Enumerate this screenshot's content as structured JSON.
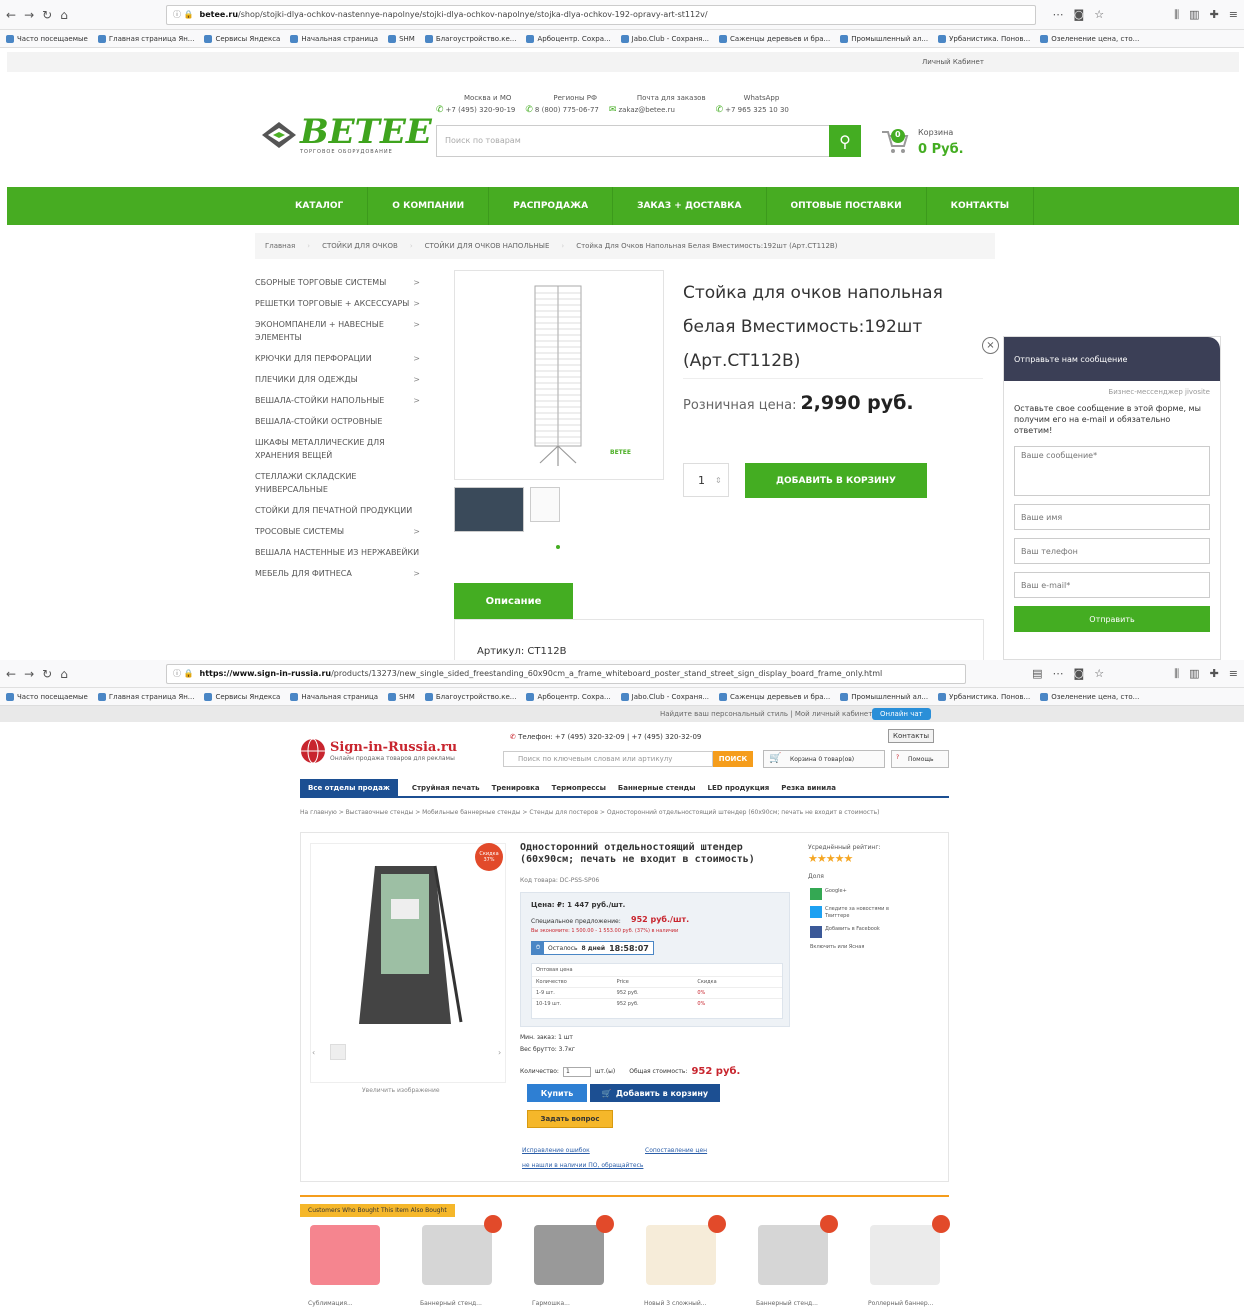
{
  "top": {
    "browser": {
      "url_prefix": "betee.ru",
      "url_rest": "/shop/stojki-dlya-ochkov-nastennye-napolnye/stojki-dlya-ochkov-napolnye/stojka-dlya-ochkov-192-opravy-art-st112v/",
      "bookmarks": [
        "Часто посещаемые",
        "Главная страница Ян...",
        "Сервисы Яндекса",
        "Начальная страница",
        "SHM",
        "Благоустройство.ке...",
        "Арбоцентр. Сохра...",
        "Jabo.Club - Сохраня...",
        "Саженцы деревьев и бра...",
        "Промышленный ал...",
        "Урбанистика. Понов...",
        "Озеленение цена, сто..."
      ]
    },
    "header": {
      "account_link": "Личный Кабинет",
      "logo_text": "BETEE",
      "logo_sub": "ТОРГОВОЕ ОБОРУДОВАНИЕ",
      "contacts": [
        {
          "label": "Москва и МО",
          "value": "+7 (495) 320-90-19"
        },
        {
          "label": "Регионы РФ",
          "value": "8 (800) 775-06-77"
        },
        {
          "label": "Почта для заказов",
          "value": "zakaz@betee.ru"
        },
        {
          "label": "WhatsApp",
          "value": "+7 965 325 10 30"
        }
      ],
      "search_placeholder": "Поиск по товарам",
      "cart_label": "Корзина",
      "cart_count": "0",
      "cart_total": "0 Руб."
    },
    "nav": [
      "КАТАЛОГ",
      "О КОМПАНИИ",
      "РАСПРОДАЖА",
      "ЗАКАЗ + ДОСТАВКА",
      "ОПТОВЫЕ ПОСТАВКИ",
      "КОНТАКТЫ"
    ],
    "breadcrumb": [
      "Главная",
      "СТОЙКИ ДЛЯ ОЧКОВ",
      "СТОЙКИ ДЛЯ ОЧКОВ НАПОЛЬНЫЕ",
      "Стойка Для Очков Напольная Белая Вместимость:192шт (Арт.СТ112В)"
    ],
    "sidebar": [
      {
        "label": "СБОРНЫЕ ТОРГОВЫЕ СИСТЕМЫ",
        "chev": ">"
      },
      {
        "label": "РЕШЕТКИ ТОРГОВЫЕ + АКСЕССУАРЫ",
        "chev": ">"
      },
      {
        "label": "ЭКОНОМПАНЕЛИ + НАВЕСНЫЕ ЭЛЕМЕНТЫ",
        "chev": ">"
      },
      {
        "label": "КРЮЧКИ ДЛЯ ПЕРФОРАЦИИ",
        "chev": ">"
      },
      {
        "label": "ПЛЕЧИКИ ДЛЯ ОДЕЖДЫ",
        "chev": ">"
      },
      {
        "label": "ВЕШАЛА-СТОЙКИ НАПОЛЬНЫЕ",
        "chev": ">"
      },
      {
        "label": "ВЕШАЛА-СТОЙКИ ОСТРОВНЫЕ",
        "chev": ""
      },
      {
        "label": "ШКАФЫ МЕТАЛЛИЧЕСКИЕ ДЛЯ ХРАНЕНИЯ ВЕЩЕЙ",
        "chev": ""
      },
      {
        "label": "СТЕЛЛАЖИ СКЛАДСКИЕ УНИВЕРСАЛЬНЫЕ",
        "chev": ""
      },
      {
        "label": "СТОЙКИ ДЛЯ ПЕЧАТНОЙ ПРОДУКЦИИ",
        "chev": ""
      },
      {
        "label": "ТРОСОВЫЕ СИСТЕМЫ",
        "chev": ">"
      },
      {
        "label": "ВЕШАЛА НАСТЕННЫЕ ИЗ НЕРЖАВЕЙКИ",
        "chev": ""
      },
      {
        "label": "МЕБЕЛЬ ДЛЯ ФИТНЕСА",
        "chev": ">"
      }
    ],
    "product": {
      "title_lines": [
        "Стойка для очков напольная",
        "белая Вместимость:192шт",
        "(Арт.СТ112В)"
      ],
      "price_label": "Розничная цена:",
      "price_value": "2,990 руб.",
      "qty": "1",
      "add_to_cart": "ДОБАВИТЬ В КОРЗИНУ",
      "tab_label": "Описание",
      "article": "Артикул: СТ112В",
      "watermark": "BETEE"
    },
    "chat": {
      "header": "Отправьте нам сообщение",
      "powered": "Бизнес-мессенджер jivosite",
      "intro": "Оставьте свое сообщение в этой форме, мы получим его на e-mail и обязательно ответим!",
      "message_ph": "Ваше сообщение*",
      "name_ph": "Ваше имя",
      "phone_ph": "Ваш телефон",
      "email_ph": "Ваш e-mail*",
      "send": "Отправить"
    }
  },
  "bottom": {
    "browser": {
      "url_prefix": "https://www.sign-in-russia.ru",
      "url_rest": "/products/13273/new_single_sided_freestanding_60x90cm_a_frame_whiteboard_poster_stand_street_sign_display_board_frame_only.html"
    },
    "topbar": {
      "links": "Найдите ваш персональный стиль | Мой личный кабинет",
      "online_chat": "Онлайн чат"
    },
    "header": {
      "logo": "Sign-in-Russia.ru",
      "logo_sub": "Онлайн продажа товаров для рекламы",
      "phone": "Телефон: +7 (495) 320-32-09  |  +7 (495) 320-32-09",
      "contacts_btn": "Контакты",
      "search_ph": "Поиск по ключевым словам или артикулу",
      "search_btn": "ПОИСК",
      "cart": "Корзина 0 товар(ов)",
      "help": "Помощь"
    },
    "nav": {
      "all": "Все отделы продаж",
      "items": [
        "Струйная печать",
        "Тренировка",
        "Термопрессы",
        "Баннерные стенды",
        "LED продукция",
        "Резка винила"
      ]
    },
    "breadcrumb": "На главную > Выставочные стенды > Мобильные баннерные стенды > Стенды для постеров > Односторонний отдельностоящий штендер (60х90см; печать не входит в стоимость)",
    "product": {
      "sale_badge": "Скидка 37%",
      "title": "Односторонний отдельностоящий штендер (60x90см; печать не входит в стоимость)",
      "code": "Код товара: DC-PSS-SP06",
      "price_old": "Цена: ₽: 1 447 руб./шт.",
      "special_label": "Специальное предложение:",
      "special_price": "952 руб./шт.",
      "saving": "Вы экономите: 1 500.00 - 1 553.00 руб. (37%) в наличии",
      "countdown_label": "Осталось",
      "countdown_days": "8 дней",
      "countdown_time": "18:58:07",
      "tier_header": "Оптовая цена",
      "tier_cols": [
        "Количество",
        "Price",
        "Скидка"
      ],
      "tier_rows": [
        [
          "1-9 шт.",
          "952 руб.",
          "0%"
        ],
        [
          "10-19 шт.",
          "952 руб.",
          "0%"
        ]
      ],
      "min_order": "Мин. заказ: 1 шт",
      "weight": "Вес брутто: 3.7кг",
      "qty_label": "Количество:",
      "qty_value": "1",
      "qty_unit": "шт.(ы)",
      "total_label": "Общая стоимость:",
      "total_value": "952 руб.",
      "buy": "Купить",
      "add_cart": "Добавить в корзину",
      "ask": "Задать вопрос",
      "link1": "Исправление ошибок",
      "link2": "Сопоставление цен",
      "link3": "не нашли в наличии ПО, обращайтесь",
      "zoom_text": "Увеличить изображение",
      "rating_label": "Усреднённый рейтинг:",
      "share_label": "Доля",
      "share1": "Google+",
      "share2": "Следите за новостями в Твиттере",
      "share3": "Добавить в Facebook",
      "share4": "Включить или Ясная"
    },
    "recommend": {
      "heading": "Customers Who Bought This Item Also Bought",
      "items": [
        "Сублимация...",
        "Баннерный стенд...",
        "Гармошка...",
        "Новый 3 сложный...",
        "Баннерный стенд...",
        "Роллерный баннер..."
      ]
    }
  }
}
